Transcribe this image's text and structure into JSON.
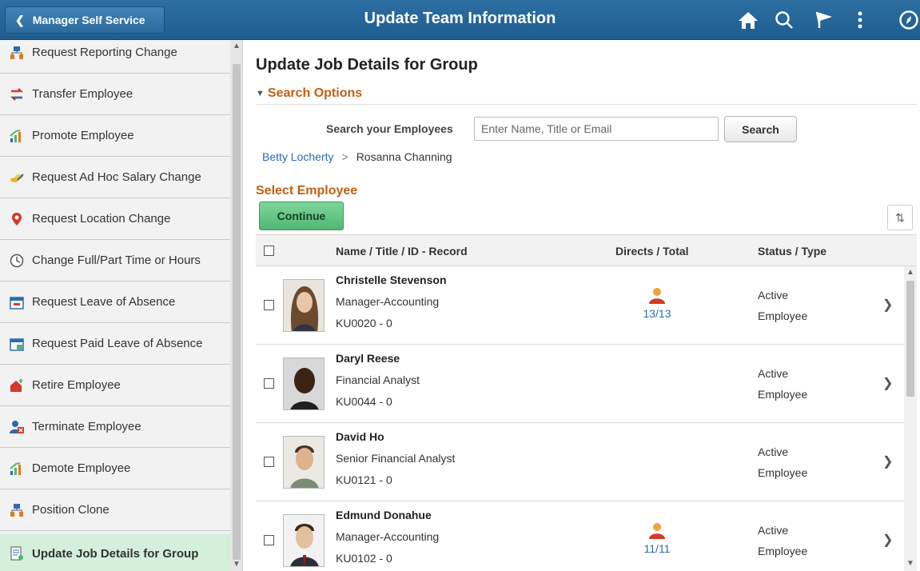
{
  "header": {
    "back_label": "Manager Self Service",
    "title": "Update Team Information",
    "icons": [
      "home-icon",
      "search-icon",
      "flag-icon",
      "more-icon",
      "navbar-icon"
    ]
  },
  "sidebar": {
    "items": [
      {
        "label": "Request Reporting Change",
        "icon": "org-chart-icon"
      },
      {
        "label": "Transfer Employee",
        "icon": "transfer-arrows-icon"
      },
      {
        "label": "Promote Employee",
        "icon": "promote-chart-icon"
      },
      {
        "label": "Request Ad Hoc Salary Change",
        "icon": "salary-coins-icon"
      },
      {
        "label": "Request Location Change",
        "icon": "location-pin-icon"
      },
      {
        "label": "Change Full/Part Time or Hours",
        "icon": "clock-icon"
      },
      {
        "label": "Request Leave of Absence",
        "icon": "calendar-icon"
      },
      {
        "label": "Request Paid Leave of Absence",
        "icon": "paid-calendar-icon"
      },
      {
        "label": "Retire Employee",
        "icon": "retire-house-icon"
      },
      {
        "label": "Terminate Employee",
        "icon": "terminate-person-icon"
      },
      {
        "label": "Demote Employee",
        "icon": "demote-chart-icon"
      },
      {
        "label": "Position Clone",
        "icon": "org-chart-icon"
      },
      {
        "label": "Update Job Details for Group",
        "icon": "job-details-icon",
        "active": true
      }
    ]
  },
  "main": {
    "page_title": "Update Job Details for Group",
    "search_options_label": "Search Options",
    "search_label": "Search your Employees",
    "search_placeholder": "Enter Name, Title or Email",
    "search_button": "Search",
    "breadcrumb": {
      "link": "Betty Locherty",
      "separator": ">",
      "current": "Rosanna Channing"
    },
    "select_employee_label": "Select Employee",
    "continue_button": "Continue",
    "columns": {
      "name": "Name / Title / ID - Record",
      "directs": "Directs / Total",
      "status": "Status / Type"
    },
    "rows": [
      {
        "name": "Christelle Stevenson",
        "title": "Manager-Accounting",
        "id": "KU0020 - 0",
        "directs": "13/13",
        "status": "Active",
        "type": "Employee"
      },
      {
        "name": "Daryl Reese",
        "title": "Financial Analyst",
        "id": "KU0044 - 0",
        "directs": "",
        "status": "Active",
        "type": "Employee"
      },
      {
        "name": "David Ho",
        "title": "Senior Financial Analyst",
        "id": "KU0121 - 0",
        "directs": "",
        "status": "Active",
        "type": "Employee"
      },
      {
        "name": "Edmund Donahue",
        "title": "Manager-Accounting",
        "id": "KU0102 - 0",
        "directs": "11/11",
        "status": "Active",
        "type": "Employee"
      }
    ]
  },
  "colors": {
    "header": "#1f5d8f",
    "accent_orange": "#c06014",
    "continue_green": "#4fb872",
    "link_blue": "#2b6cb0",
    "active_item": "#d4efda"
  }
}
